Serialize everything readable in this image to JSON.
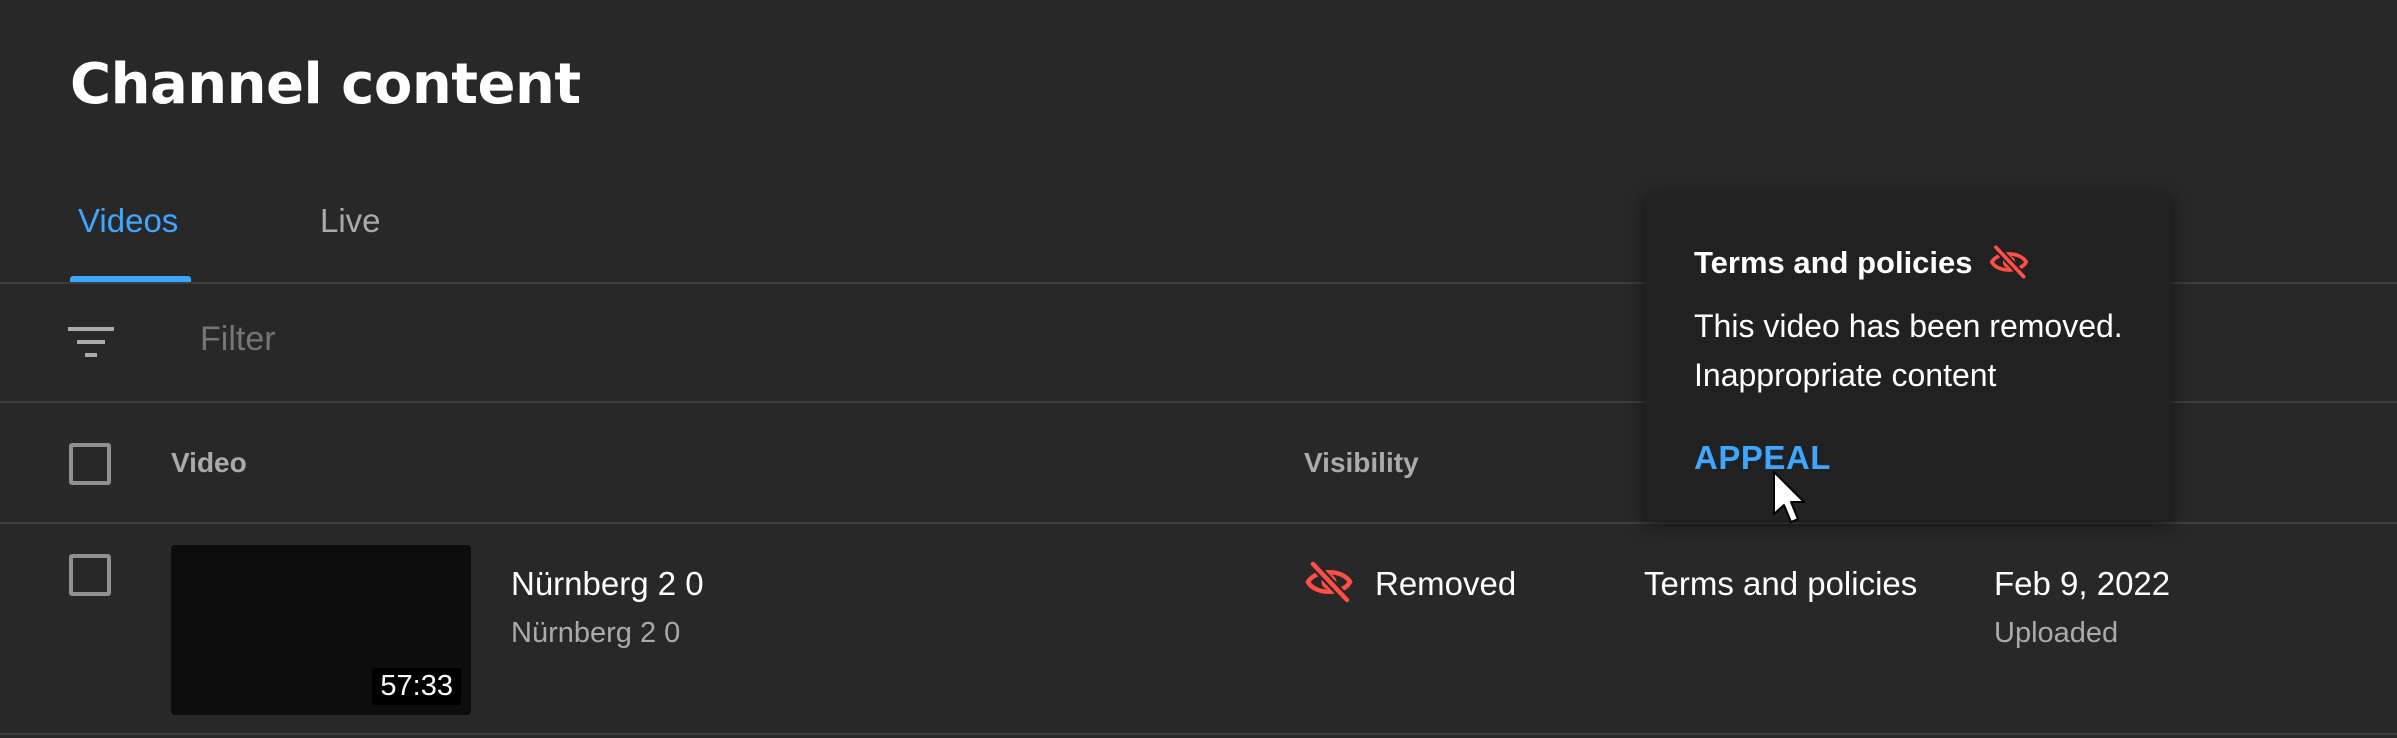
{
  "page": {
    "title": "Channel content"
  },
  "tabs": [
    {
      "label": "Videos",
      "active": true
    },
    {
      "label": "Live",
      "active": false
    }
  ],
  "filter": {
    "icon": "filter-icon",
    "placeholder": "Filter"
  },
  "table": {
    "headers": {
      "video": "Video",
      "visibility": "Visibility"
    },
    "rows": [
      {
        "thumbnail_duration": "57:33",
        "title": "Nürnberg 2 0",
        "description": "Nürnberg 2 0",
        "visibility": "Removed",
        "visibility_icon": "visibility-off-icon",
        "restrictions": "Terms and policies",
        "date": "Feb 9, 2022",
        "date_label": "Uploaded"
      }
    ]
  },
  "popup": {
    "title": "Terms and policies",
    "icon": "visibility-off-icon",
    "line1": "This video has been removed.",
    "line2": "Inappropriate content",
    "action": "APPEAL"
  },
  "colors": {
    "background": "#282828",
    "accent": "#3ea6ff",
    "removed": "#ff4e45",
    "popup_bg": "#212121",
    "divider": "#3d3d3d"
  }
}
